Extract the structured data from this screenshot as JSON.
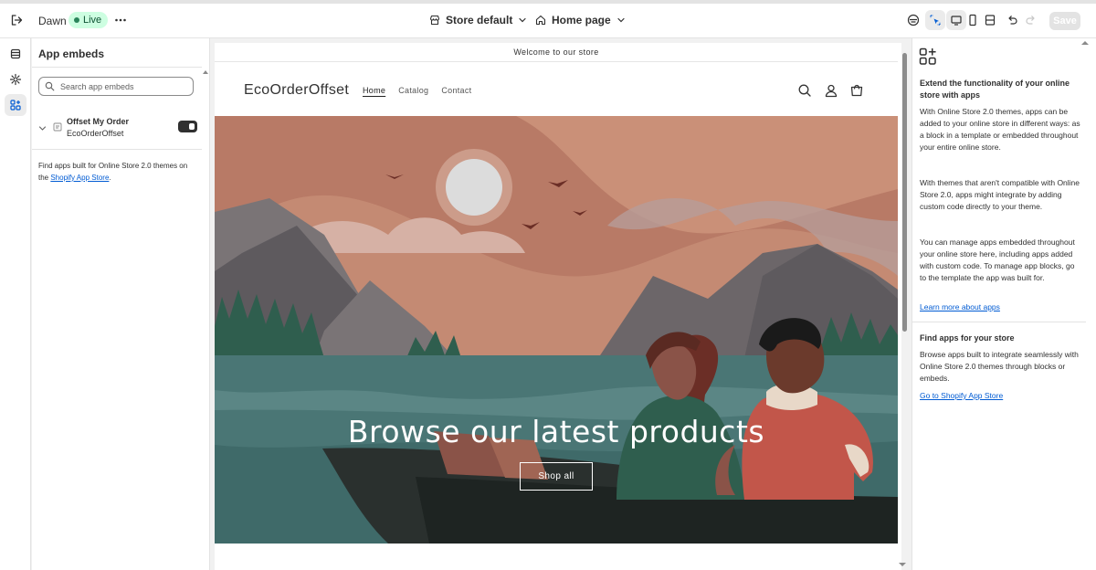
{
  "topbar": {
    "theme_name": "Dawn",
    "status_badge": "Live",
    "store_selector": "Store default",
    "page_selector": "Home page",
    "save_label": "Save"
  },
  "sidebar": {
    "title": "App embeds",
    "search_placeholder": "Search app embeds",
    "app": {
      "name": "Offset My Order",
      "provider": "EcoOrderOffset",
      "enabled": true
    },
    "help_text": "Find apps built for Online Store 2.0 themes on the ",
    "help_link": "Shopify App Store",
    "help_suffix": "."
  },
  "preview": {
    "announcement": "Welcome to our store",
    "logo": "EcoOrderOffset",
    "nav": [
      "Home",
      "Catalog",
      "Contact"
    ],
    "hero_title": "Browse our latest products",
    "hero_button": "Shop all"
  },
  "right_panel": {
    "heading": "Extend the functionality of your online store with apps",
    "para1": "With Online Store 2.0 themes, apps can be added to your online store in different ways: as a block in a template or embedded throughout your entire online store.",
    "para2": "With themes that aren't compatible with Online Store 2.0, apps might integrate by adding custom code directly to your theme.",
    "para3": "You can manage apps embedded throughout your online store here, including apps added with custom code. To manage app blocks, go to the template the app was built for.",
    "link1": "Learn more about apps",
    "heading2": "Find apps for your store",
    "para4": "Browse apps built to integrate seamlessly with Online Store 2.0 themes through blocks or embeds.",
    "link2": "Go to Shopify App Store"
  },
  "colors": {
    "accent_link": "#005bd3",
    "live_badge_bg": "#cdfee1",
    "live_dot": "#29845a"
  }
}
